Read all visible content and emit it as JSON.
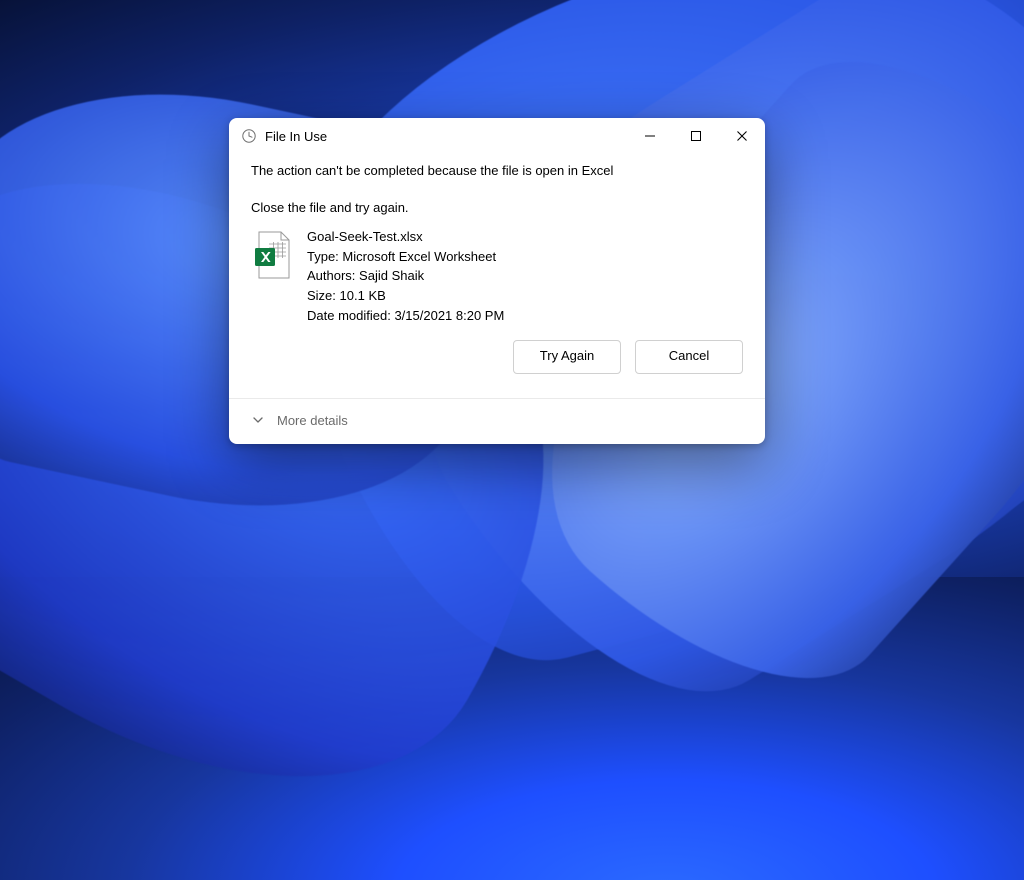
{
  "dialog": {
    "title": "File In Use",
    "message1": "The action can't be completed because the file is open in Excel",
    "message2": "Close the file and try again.",
    "file": {
      "name": "Goal-Seek-Test.xlsx",
      "type_label": "Type:",
      "type_value": "Microsoft Excel Worksheet",
      "authors_label": "Authors:",
      "authors_value": "Sajid Shaik",
      "size_label": "Size:",
      "size_value": "10.1 KB",
      "modified_label": "Date modified:",
      "modified_value": "3/15/2021 8:20 PM"
    },
    "buttons": {
      "try_again": "Try Again",
      "cancel": "Cancel"
    },
    "more_details": "More details"
  }
}
